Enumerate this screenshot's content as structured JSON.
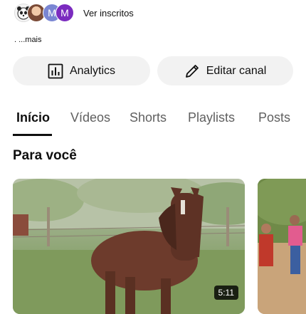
{
  "subscribers": {
    "avatars": [
      {
        "name": "panda-avatar",
        "text": ""
      },
      {
        "name": "photo-avatar",
        "text": ""
      },
      {
        "name": "m-avatar-1",
        "text": "M",
        "color": "#7a86d3"
      },
      {
        "name": "m-avatar-2",
        "text": "M",
        "color": "#7b2bbf"
      }
    ],
    "link_label": "Ver inscritos"
  },
  "description_more": ". ...mais",
  "actions": {
    "analytics_label": "Analytics",
    "analytics_icon": "bar-chart-icon",
    "edit_label": "Editar canal",
    "edit_icon": "pencil-icon"
  },
  "tabs": [
    {
      "label": "Início",
      "active": true
    },
    {
      "label": "Vídeos",
      "active": false
    },
    {
      "label": "Shorts",
      "active": false
    },
    {
      "label": "Playlists",
      "active": false
    },
    {
      "label": "Posts",
      "active": false
    }
  ],
  "section_title": "Para você",
  "videos": [
    {
      "duration": "5:11"
    },
    {
      "duration": ""
    }
  ]
}
